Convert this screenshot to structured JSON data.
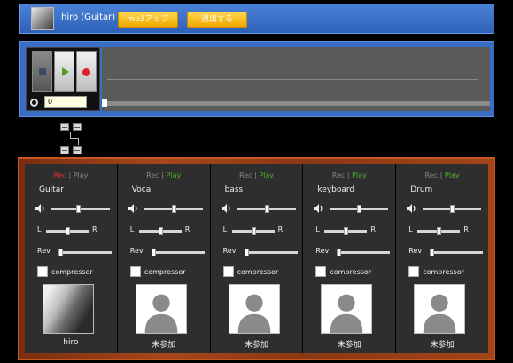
{
  "header": {
    "username": "hiro (Guitar)",
    "mp3_button": "mp3アップ",
    "leave_button": "退出する"
  },
  "transport": {
    "time_value": "0"
  },
  "mixer": {
    "rec_label": "Rec",
    "play_label": "Play",
    "separator": "|",
    "pan_left_label": "L",
    "pan_right_label": "R",
    "rev_label": "Rev",
    "compressor_label": "compressor",
    "channels": [
      {
        "part": "Guitar",
        "member": "hiro",
        "rec_active": true,
        "volume": 0.45,
        "pan": 0.5,
        "rev": 0.0,
        "compressor": false
      },
      {
        "part": "Vocal",
        "member": "未参加",
        "rec_active": false,
        "volume": 0.5,
        "pan": 0.5,
        "rev": 0.0,
        "compressor": false
      },
      {
        "part": "bass",
        "member": "未参加",
        "rec_active": false,
        "volume": 0.5,
        "pan": 0.5,
        "rev": 0.0,
        "compressor": false
      },
      {
        "part": "keyboard",
        "member": "未参加",
        "rec_active": false,
        "volume": 0.5,
        "pan": 0.5,
        "rev": 0.0,
        "compressor": false
      },
      {
        "part": "Drum",
        "member": "未参加",
        "rec_active": false,
        "volume": 0.5,
        "pan": 0.5,
        "rev": 0.0,
        "compressor": false
      }
    ]
  },
  "colors": {
    "header_bg": "#3a72c8",
    "button_yellow": "#f6c21a",
    "rec_red": "#e03030",
    "play_green": "#4caf30",
    "mixer_wood": "#a8461a"
  },
  "icons": {
    "avatar": "user-avatar-icon",
    "stop": "stop-icon",
    "play": "play-icon",
    "rec": "record-icon",
    "clock": "clock-icon",
    "volume": "speaker-icon",
    "placeholder_avatar": "person-silhouette-icon",
    "connector": "network-node-icon"
  }
}
